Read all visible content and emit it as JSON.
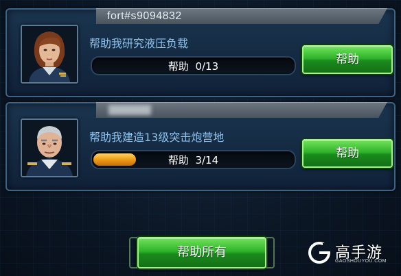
{
  "requests": [
    {
      "username": "fort#s9094832",
      "message": "帮助我研究液压负载",
      "progress_label": "帮助",
      "progress_count": "0/13",
      "progress_fraction": 0.0,
      "help_button_label": "帮助",
      "avatar": "female-officer-portrait"
    },
    {
      "username": "",
      "message": "帮助我建造13级突击炮营地",
      "progress_label": "帮助",
      "progress_count": "3/14",
      "progress_fraction": 0.214,
      "help_button_label": "帮助",
      "avatar": "male-general-portrait"
    }
  ],
  "footer": {
    "help_all_label": "帮助所有"
  },
  "watermark": {
    "title": "高手游",
    "subtitle": "GAOSHOUYOU.COM"
  },
  "colors": {
    "accent_green": "#2fb32a",
    "progress_orange": "#f3a21c",
    "message_blue": "#8fc2ec",
    "panel_border": "#3d6386"
  }
}
